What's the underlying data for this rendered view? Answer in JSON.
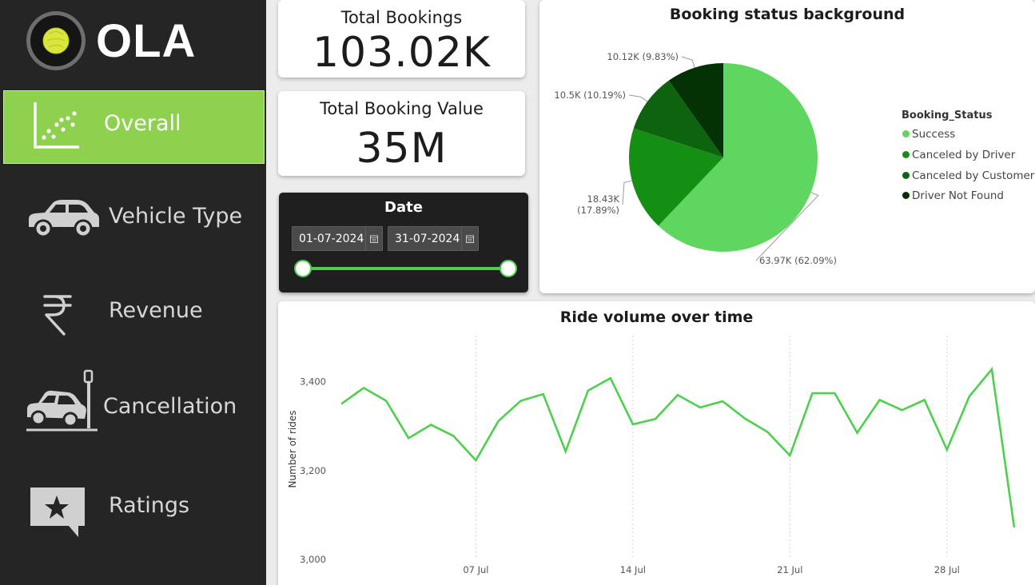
{
  "brand": {
    "name": "OLA"
  },
  "sidebar": {
    "items": [
      {
        "label": "Overall",
        "icon": "scatter-chart-icon",
        "active": true
      },
      {
        "label": "Vehicle Type",
        "icon": "car-icon",
        "active": false
      },
      {
        "label": "Revenue",
        "icon": "rupee-icon",
        "active": false
      },
      {
        "label": "Cancellation",
        "icon": "car-crash-icon",
        "active": false
      },
      {
        "label": "Ratings",
        "icon": "star-chat-icon",
        "active": false
      }
    ]
  },
  "kpis": {
    "total_bookings": {
      "title": "Total Bookings",
      "value": "103.02K"
    },
    "total_booking_value": {
      "title": "Total Booking Value",
      "value": "35M"
    }
  },
  "date_filter": {
    "title": "Date",
    "start": "01-07-2024",
    "end": "31-07-2024",
    "range_selected": [
      0,
      1
    ]
  },
  "colors": {
    "success": "#5fd65f",
    "canceled_by_driver": "#148f14",
    "canceled_by_customer": "#0e640e",
    "driver_not_found": "#053205",
    "line": "#4ed04e",
    "active_nav": "#8ed14f"
  },
  "chart_data": [
    {
      "type": "pie",
      "title": "Booking status background",
      "legend_title": "Booking_Status",
      "legend_position": "right",
      "slices": [
        {
          "name": "Success",
          "value": 63.97,
          "percent": 62.09,
          "label": "63.97K (62.09%)"
        },
        {
          "name": "Canceled by Driver",
          "value": 18.43,
          "percent": 17.89,
          "label_lines": [
            "18.43K",
            "(17.89%)"
          ]
        },
        {
          "name": "Canceled by Customer",
          "value": 10.5,
          "percent": 10.19,
          "label": "10.5K (10.19%)"
        },
        {
          "name": "Driver Not Found",
          "value": 10.12,
          "percent": 9.83,
          "label": "10.12K (9.83%)"
        }
      ]
    },
    {
      "type": "line",
      "title": "Ride volume over time",
      "xlabel": "",
      "ylabel": "Number of rides",
      "ylim": [
        3000,
        3500
      ],
      "yticks": [
        3000,
        3200,
        3400
      ],
      "ytick_labels": [
        "3,000",
        "3,200",
        "3,400"
      ],
      "xticks": [
        7,
        14,
        21,
        28
      ],
      "xtick_labels": [
        "07 Jul",
        "14 Jul",
        "21 Jul",
        "28 Jul"
      ],
      "x": [
        1,
        2,
        3,
        4,
        5,
        6,
        7,
        8,
        9,
        10,
        11,
        12,
        13,
        14,
        15,
        16,
        17,
        18,
        19,
        20,
        21,
        22,
        23,
        24,
        25,
        26,
        27,
        28,
        29,
        30,
        31
      ],
      "values": [
        3350,
        3386,
        3357,
        3273,
        3303,
        3278,
        3223,
        3311,
        3357,
        3372,
        3243,
        3380,
        3408,
        3304,
        3316,
        3370,
        3342,
        3356,
        3317,
        3287,
        3234,
        3374,
        3374,
        3285,
        3359,
        3336,
        3359,
        3247,
        3367,
        3428,
        3072
      ]
    }
  ]
}
